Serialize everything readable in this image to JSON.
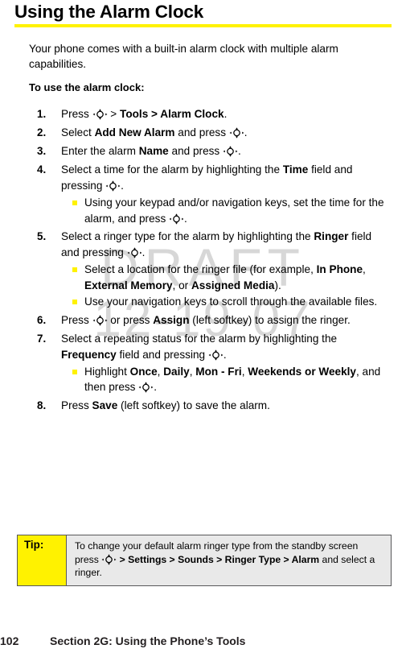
{
  "document": {
    "title": "Using the Alarm Clock",
    "rule_color": "#fff200",
    "watermark": {
      "line1": "DRAFT",
      "line2": "12-19-07",
      "color": "#d7d7d7"
    }
  },
  "intro": {
    "paragraph": "Your phone comes with a built-in alarm clock with multiple alarm capabilities.",
    "lead_in": "To use the alarm clock:"
  },
  "icons": {
    "navigation_key": "navigation-key-icon"
  },
  "steps": [
    {
      "number": "1.",
      "parts": [
        {
          "t": "text",
          "v": "Press "
        },
        {
          "t": "icon",
          "v": "navigation-key-icon"
        },
        {
          "t": "text",
          "v": " > "
        },
        {
          "t": "bold",
          "v": "Tools"
        },
        {
          "t": "bold",
          "v": " > "
        },
        {
          "t": "bold",
          "v": "Alarm Clock"
        },
        {
          "t": "text",
          "v": "."
        }
      ],
      "subs": []
    },
    {
      "number": "2.",
      "parts": [
        {
          "t": "text",
          "v": "Select "
        },
        {
          "t": "bold",
          "v": "Add New Alarm"
        },
        {
          "t": "text",
          "v": " and press "
        },
        {
          "t": "icon",
          "v": "navigation-key-icon"
        },
        {
          "t": "text",
          "v": "."
        }
      ],
      "subs": []
    },
    {
      "number": "3.",
      "parts": [
        {
          "t": "text",
          "v": "Enter the alarm "
        },
        {
          "t": "bold",
          "v": "Name"
        },
        {
          "t": "text",
          "v": " and press "
        },
        {
          "t": "icon",
          "v": "navigation-key-icon"
        },
        {
          "t": "text",
          "v": "."
        }
      ],
      "subs": []
    },
    {
      "number": "4.",
      "parts": [
        {
          "t": "text",
          "v": "Select a time for the alarm by highlighting the "
        },
        {
          "t": "bold",
          "v": "Time"
        },
        {
          "t": "text",
          "v": " field and pressing "
        },
        {
          "t": "icon",
          "v": "navigation-key-icon"
        },
        {
          "t": "text",
          "v": "."
        }
      ],
      "subs": [
        {
          "parts": [
            {
              "t": "text",
              "v": "Using your keypad and/or navigation keys, set the time for the alarm, and press "
            },
            {
              "t": "icon",
              "v": "navigation-key-icon"
            },
            {
              "t": "text",
              "v": "."
            }
          ]
        }
      ]
    },
    {
      "number": "5.",
      "parts": [
        {
          "t": "text",
          "v": "Select a ringer type for the alarm by highlighting the "
        },
        {
          "t": "bold",
          "v": "Ringer"
        },
        {
          "t": "text",
          "v": " field and pressing "
        },
        {
          "t": "icon",
          "v": "navigation-key-icon"
        },
        {
          "t": "text",
          "v": "."
        }
      ],
      "subs": [
        {
          "parts": [
            {
              "t": "text",
              "v": "Select a location for the ringer file (for example, "
            },
            {
              "t": "bold",
              "v": "In Phone"
            },
            {
              "t": "text",
              "v": ", "
            },
            {
              "t": "bold",
              "v": "External Memory"
            },
            {
              "t": "text",
              "v": ", or "
            },
            {
              "t": "bold",
              "v": "Assigned Media"
            },
            {
              "t": "text",
              "v": ")."
            }
          ]
        },
        {
          "parts": [
            {
              "t": "text",
              "v": "Use your navigation keys to scroll through the available files."
            }
          ]
        }
      ]
    },
    {
      "number": "6.",
      "parts": [
        {
          "t": "text",
          "v": "Press "
        },
        {
          "t": "icon",
          "v": "navigation-key-icon"
        },
        {
          "t": "text",
          "v": " or press "
        },
        {
          "t": "bold",
          "v": "Assign"
        },
        {
          "t": "text",
          "v": " (left softkey) to assign the ringer."
        }
      ],
      "subs": []
    },
    {
      "number": "7.",
      "parts": [
        {
          "t": "text",
          "v": "Select a repeating status for the alarm by highlighting the "
        },
        {
          "t": "bold",
          "v": "Frequency"
        },
        {
          "t": "text",
          "v": " field and pressing "
        },
        {
          "t": "icon",
          "v": "navigation-key-icon"
        },
        {
          "t": "text",
          "v": "."
        }
      ],
      "subs": [
        {
          "parts": [
            {
              "t": "text",
              "v": "Highlight "
            },
            {
              "t": "bold",
              "v": "Once"
            },
            {
              "t": "text",
              "v": ", "
            },
            {
              "t": "bold",
              "v": "Daily"
            },
            {
              "t": "text",
              "v": ", "
            },
            {
              "t": "bold",
              "v": "Mon - Fri"
            },
            {
              "t": "text",
              "v": ", "
            },
            {
              "t": "bold",
              "v": "Weekends or Weekly"
            },
            {
              "t": "text",
              "v": ", and then press "
            },
            {
              "t": "icon",
              "v": "navigation-key-icon"
            },
            {
              "t": "text",
              "v": "."
            }
          ]
        }
      ]
    },
    {
      "number": "8.",
      "parts": [
        {
          "t": "text",
          "v": "Press "
        },
        {
          "t": "bold",
          "v": "Save"
        },
        {
          "t": "text",
          "v": " (left softkey) to save the alarm."
        }
      ],
      "subs": []
    }
  ],
  "tip": {
    "label": "Tip:",
    "label_bg": "#fff200",
    "body_bg": "#e9e9e9",
    "parts": [
      {
        "t": "text",
        "v": "To change your default alarm ringer type from the standby screen press "
      },
      {
        "t": "icon",
        "v": "navigation-key-icon"
      },
      {
        "t": "text",
        "v": " "
      },
      {
        "t": "bold",
        "v": "> Settings > Sounds > Ringer Type > Alarm"
      },
      {
        "t": "text",
        "v": "  and select a ringer."
      }
    ]
  },
  "footer": {
    "page_number": "102",
    "section": "Section 2G: Using the Phone’s Tools"
  }
}
